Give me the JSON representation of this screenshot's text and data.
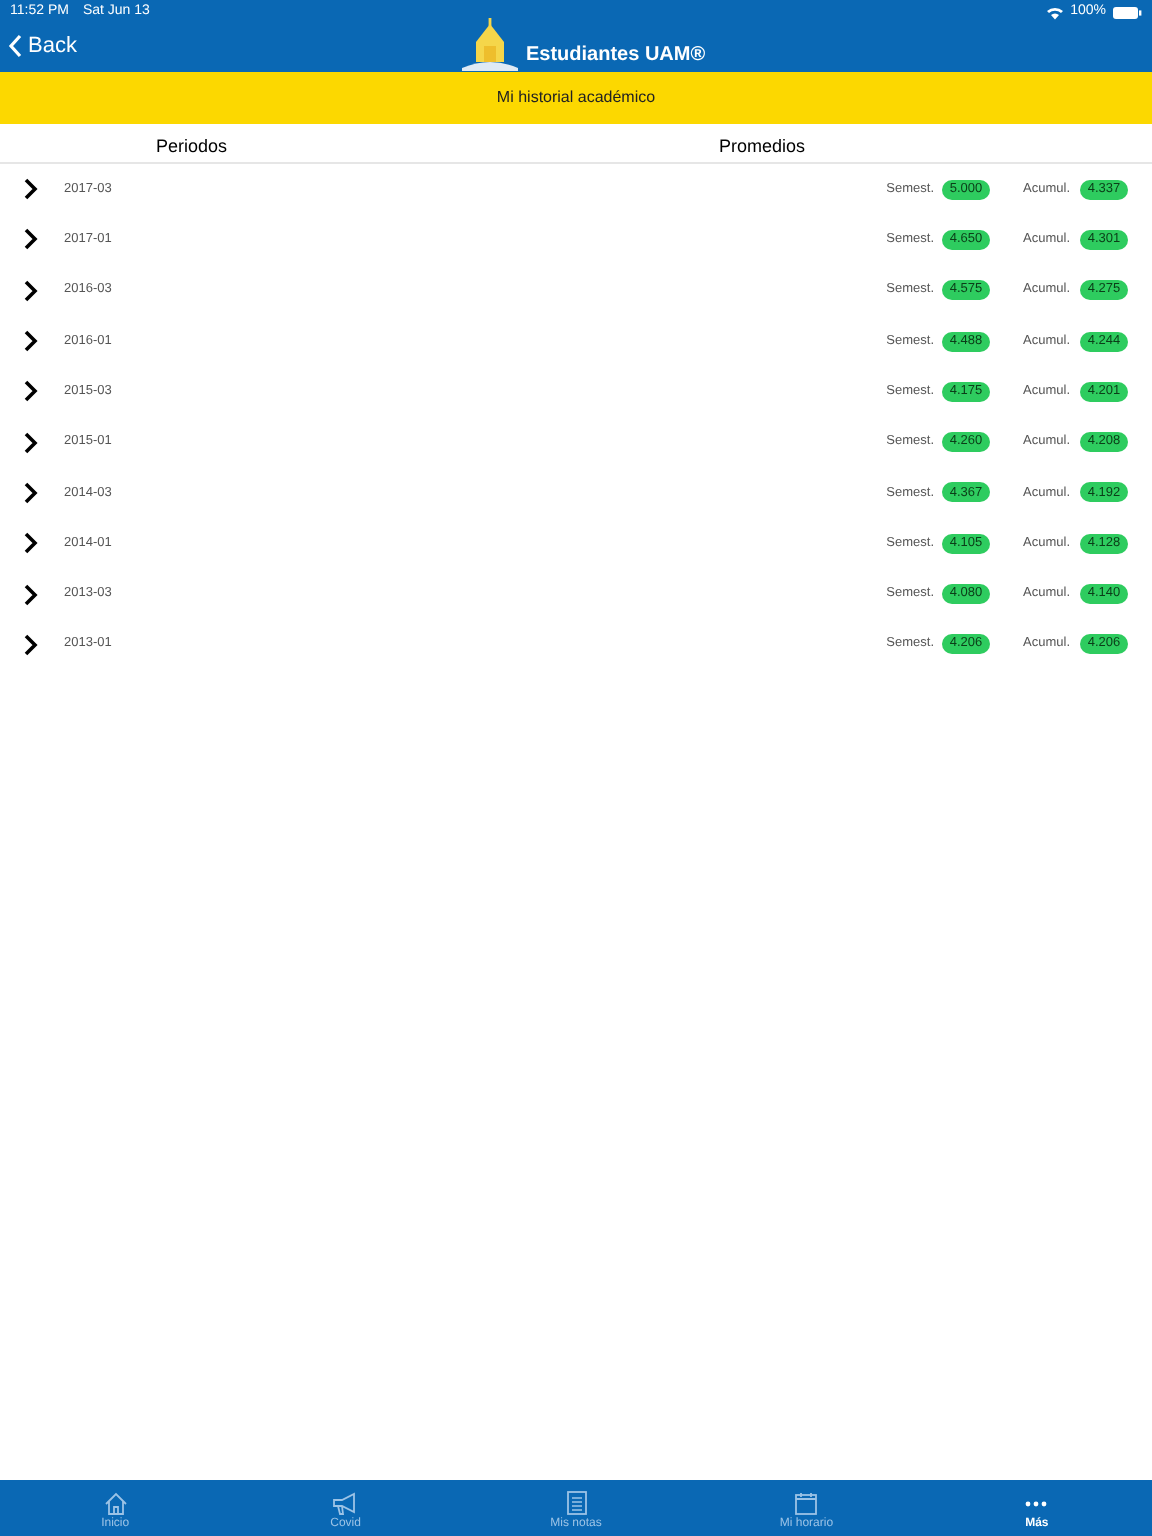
{
  "status_bar": {
    "time": "11:52 PM",
    "date": "Sat Jun 13",
    "battery": "100%"
  },
  "nav": {
    "back": "Back",
    "title": "Estudiantes UAM®"
  },
  "banner": "Mi historial académico",
  "columns": [
    "Periodos",
    "Promedios"
  ],
  "rows": [
    {
      "period": "2017-03",
      "semester_label": "Semest.",
      "semester": "5.000",
      "cumulative_label": "Acumul.",
      "cumulative": "4.337"
    },
    {
      "period": "2017-01",
      "semester_label": "Semest.",
      "semester": "4.650",
      "cumulative_label": "Acumul.",
      "cumulative": "4.301"
    },
    {
      "period": "2016-03",
      "semester_label": "Semest.",
      "semester": "4.575",
      "cumulative_label": "Acumul.",
      "cumulative": "4.275"
    },
    {
      "period": "2016-01",
      "semester_label": "Semest.",
      "semester": "4.488",
      "cumulative_label": "Acumul.",
      "cumulative": "4.244"
    },
    {
      "period": "2015-03",
      "semester_label": "Semest.",
      "semester": "4.175",
      "cumulative_label": "Acumul.",
      "cumulative": "4.201"
    },
    {
      "period": "2015-01",
      "semester_label": "Semest.",
      "semester": "4.260",
      "cumulative_label": "Acumul.",
      "cumulative": "4.208"
    },
    {
      "period": "2014-03",
      "semester_label": "Semest.",
      "semester": "4.367",
      "cumulative_label": "Acumul.",
      "cumulative": "4.192"
    },
    {
      "period": "2014-01",
      "semester_label": "Semest.",
      "semester": "4.105",
      "cumulative_label": "Acumul.",
      "cumulative": "4.128"
    },
    {
      "period": "2013-03",
      "semester_label": "Semest.",
      "semester": "4.080",
      "cumulative_label": "Acumul.",
      "cumulative": "4.140"
    },
    {
      "period": "2013-01",
      "semester_label": "Semest.",
      "semester": "4.206",
      "cumulative_label": "Acumul.",
      "cumulative": "4.206"
    }
  ],
  "tab_bar": [
    {
      "label": "Inicio",
      "kind": "home",
      "selected": false
    },
    {
      "label": "Covid",
      "kind": "megaphone",
      "selected": false
    },
    {
      "label": "Mis notas",
      "kind": "notes",
      "selected": false
    },
    {
      "label": "Mi horario",
      "kind": "calendar",
      "selected": false
    },
    {
      "label": "Más",
      "kind": "more",
      "selected": true
    }
  ]
}
